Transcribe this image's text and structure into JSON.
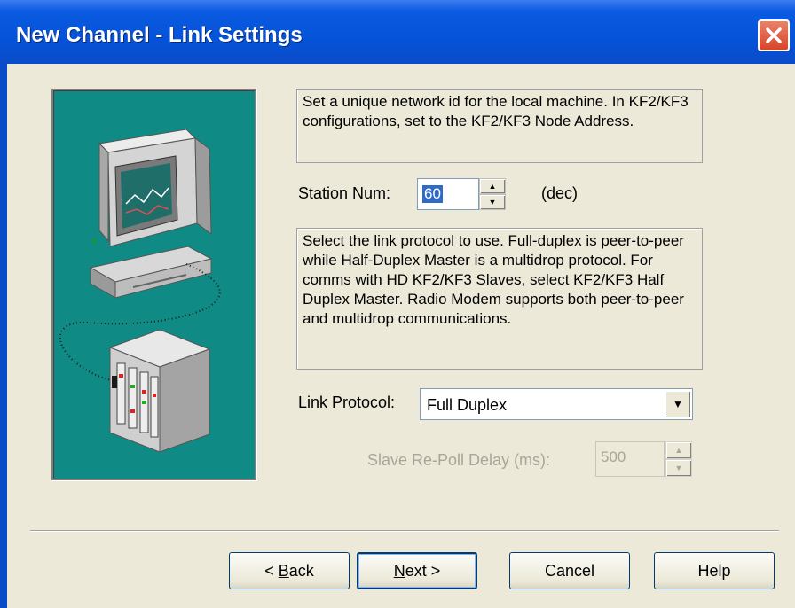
{
  "window": {
    "title": "New Channel - Link Settings"
  },
  "station_help": "Set a unique network id for the local machine. In KF2/KF3 configurations, set to the KF2/KF3 Node Address.",
  "station": {
    "label": "Station Num:",
    "value": "60",
    "unit": "(dec)"
  },
  "protocol_help": "Select the link protocol to use.  Full-duplex is peer-to-peer while Half-Duplex Master is a multidrop protocol.  For comms with HD KF2/KF3 Slaves, select KF2/KF3 Half Duplex Master.  Radio Modem supports both peer-to-peer and multidrop communications.",
  "link_protocol": {
    "label": "Link Protocol:",
    "value": "Full Duplex"
  },
  "repoll": {
    "label": "Slave Re-Poll Delay (ms):",
    "value": "500"
  },
  "buttons": {
    "back_prefix": "< ",
    "back_hot": "B",
    "back_rest": "ack",
    "next_hot": "N",
    "next_rest": "ext >",
    "cancel": "Cancel",
    "help": "Help"
  },
  "icons": [
    "close-icon",
    "computer-icon",
    "plc-rack-icon",
    "spin-up-icon",
    "spin-down-icon",
    "dropdown-arrow-icon"
  ],
  "colors": {
    "titlebar": "#0553d8",
    "illustration_bg": "#0f8a84",
    "dialog_bg": "#ece9d8",
    "close": "#d6462a"
  }
}
